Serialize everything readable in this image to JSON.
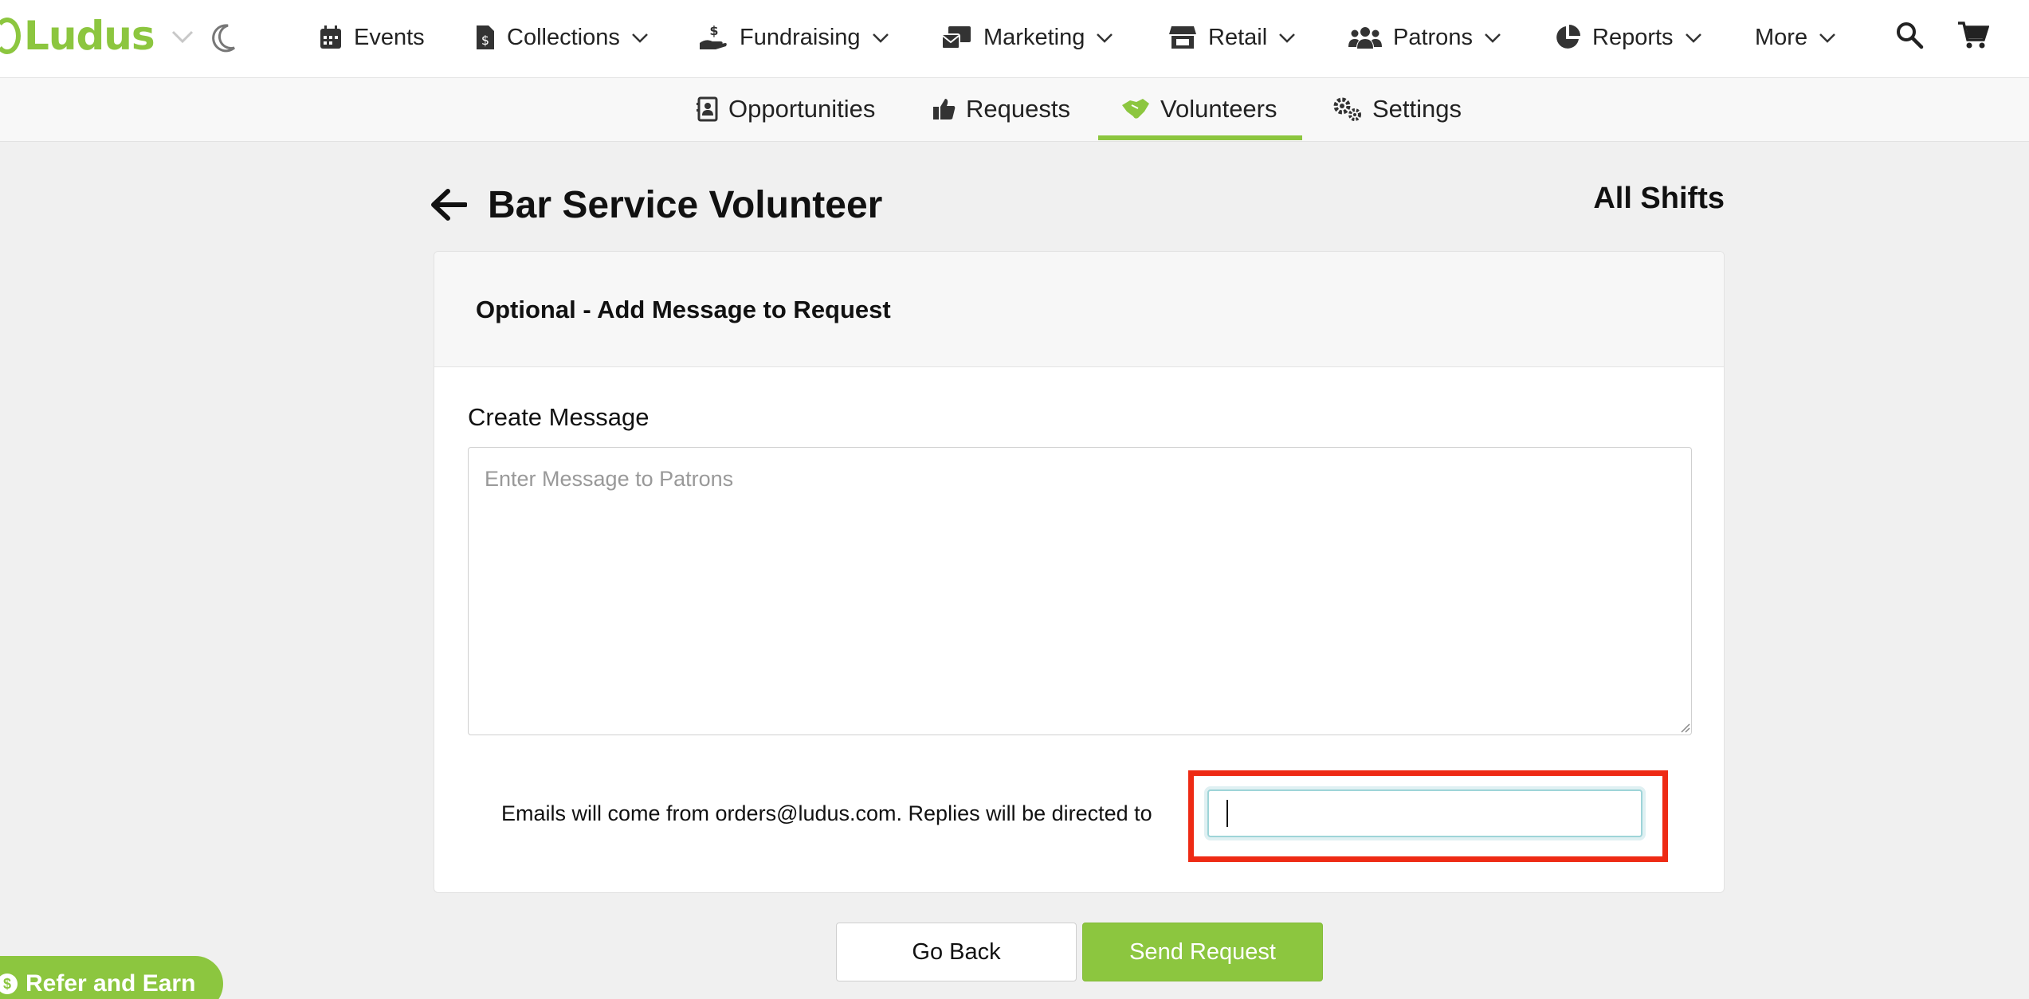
{
  "app": {
    "logo_text": "Ludus"
  },
  "nav": {
    "items": [
      {
        "label": "Events"
      },
      {
        "label": "Collections"
      },
      {
        "label": "Fundraising"
      },
      {
        "label": "Marketing"
      },
      {
        "label": "Retail"
      },
      {
        "label": "Patrons"
      },
      {
        "label": "Reports"
      },
      {
        "label": "More"
      }
    ]
  },
  "subnav": {
    "items": [
      {
        "label": "Opportunities"
      },
      {
        "label": "Requests"
      },
      {
        "label": "Volunteers",
        "active": true
      },
      {
        "label": "Settings"
      }
    ]
  },
  "page": {
    "title": "Bar Service Volunteer",
    "right_link": "All Shifts"
  },
  "card": {
    "title": "Optional - Add Message to Request",
    "message_label": "Create Message",
    "message_placeholder": "Enter Message to Patrons",
    "reply_text": "Emails will come from orders@ludus.com. Replies will be directed to",
    "reply_value": ""
  },
  "buttons": {
    "back": "Go Back",
    "send": "Send Request"
  },
  "refer": {
    "label": "Refer and Earn"
  },
  "colors": {
    "brand": "#8cc63f",
    "highlight": "#ee2a14",
    "focus": "#9ed4d8"
  }
}
